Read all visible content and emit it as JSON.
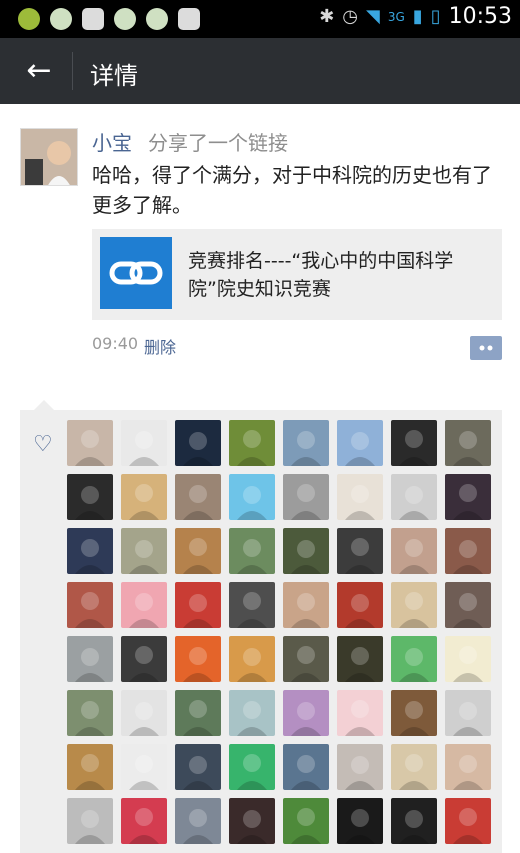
{
  "status_bar": {
    "time": "10:53",
    "network": "3G",
    "left_icons": [
      "sync-icon",
      "wechat-icon",
      "image-icon",
      "wechat-icon",
      "wechat-icon",
      "message-icon"
    ],
    "right_icons": [
      "bluetooth-icon",
      "alarm-icon",
      "wifi-icon",
      "signal-icon",
      "battery-icon"
    ]
  },
  "action_bar": {
    "title": "详情",
    "back_icon": "arrow-left-icon"
  },
  "post": {
    "user_name": "小宝",
    "action": "分享了一个链接",
    "text": "哈哈，得了个满分，对于中科院的历史也有了更多了解。",
    "link": {
      "title": "竞赛排名----“我心中的中国科学院”院史知识竞赛",
      "icon": "link-icon",
      "accent": "#1f7ed2"
    },
    "time": "09:40",
    "delete_label": "删除"
  },
  "likes": {
    "icon": "heart-outline-icon",
    "avatars": [
      "#c8b6a8",
      "#e9e9e9",
      "#1c2a3f",
      "#6f8d38",
      "#7d9bb8",
      "#8fb1d8",
      "#2a2a2a",
      "#6c6a5c",
      "#2b2b2b",
      "#d6b27a",
      "#9a8574",
      "#6ec4e8",
      "#9c9c9c",
      "#e8e1d7",
      "#cfcfcf",
      "#3a2e3a",
      "#2e3a57",
      "#a4a48b",
      "#b5824c",
      "#6c8c5f",
      "#4c5a3b",
      "#3c3c3c",
      "#c2a08e",
      "#8a5a4a",
      "#b05748",
      "#f0a6b1",
      "#c93c34",
      "#4e4e4e",
      "#c9a489",
      "#b33a2c",
      "#d8c39e",
      "#6f5d55",
      "#9ba0a2",
      "#3b3b3b",
      "#e4642a",
      "#d89a4a",
      "#5a5a4a",
      "#3a3a2a",
      "#5db869",
      "#f2ecd1",
      "#7d8f6f",
      "#e3e3e3",
      "#5e7a5a",
      "#a8c3c6",
      "#b48fc2",
      "#f3d0d4",
      "#7e5a3a",
      "#cfcfcf",
      "#b88a4a",
      "#ececec",
      "#3d4a5a",
      "#37b46c",
      "#5a7590",
      "#c4bcb6",
      "#d8c8a8",
      "#d6b9a3",
      "#bcbcbc",
      "#d43c50",
      "#7e8896",
      "#3a2a2a",
      "#4e8a3a",
      "#1a1a1a",
      "#202020",
      "#c93c34"
    ]
  }
}
